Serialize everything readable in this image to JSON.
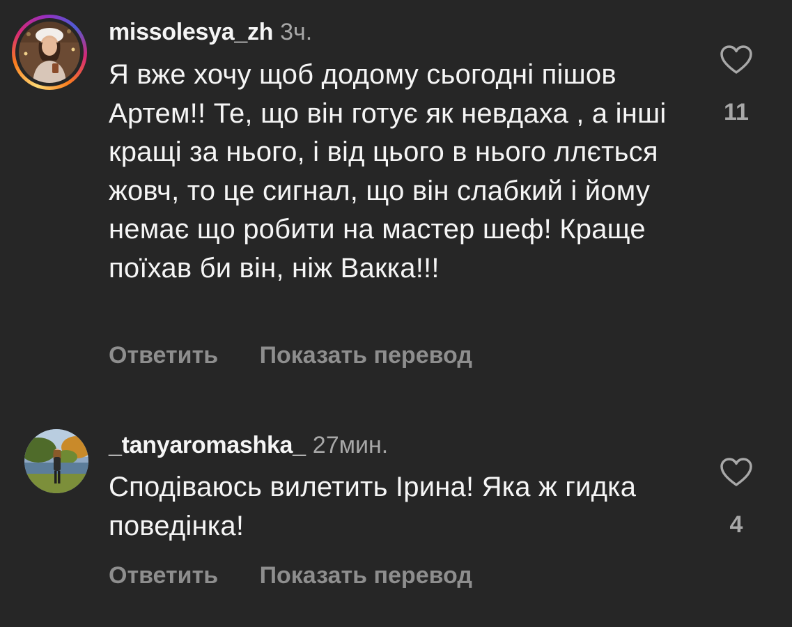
{
  "comments": [
    {
      "username": "missolesya_zh",
      "time": "3ч.",
      "text": "Я вже хочу щоб додому сьогодні пішов Артем!! Те, що він готує як невдаха , а інші кращі за нього, і від цього в нього ллється жовч, то це сигнал, що він слабкий і йому немає що робити на мастер шеф! Краще поїхав би він, ніж Вакка!!!",
      "reply_label": "Ответить",
      "translate_label": "Показать перевод",
      "likes": "11",
      "avatar_story_ring": true
    },
    {
      "username": "_tanyaromashka_",
      "time": "27мин.",
      "text": "Сподіваюсь вилетить Ірина! Яка ж гидка поведінка!",
      "reply_label": "Ответить",
      "translate_label": "Показать перевод",
      "likes": "4",
      "avatar_story_ring": false
    }
  ],
  "icons": {
    "like": "heart-outline-icon"
  },
  "colors": {
    "background": "#262626",
    "text_primary": "#f5f5f5",
    "text_secondary": "#a8a8a8",
    "action_text": "#8e8e8e"
  }
}
